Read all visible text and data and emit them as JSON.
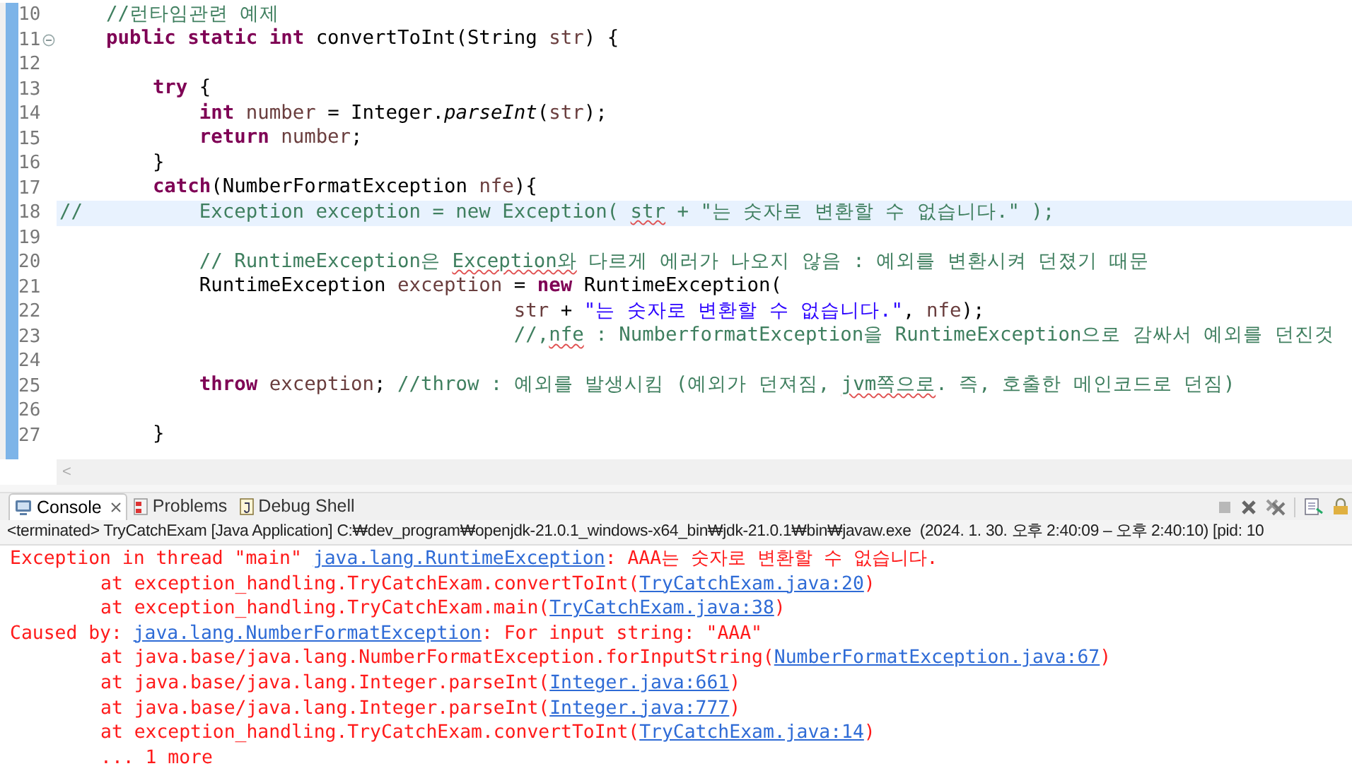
{
  "editor": {
    "lines": [
      {
        "number": "10",
        "current": false,
        "fold": false,
        "tokens": [
          {
            "kind": "comment",
            "text": "    //런타임관련 예제"
          }
        ]
      },
      {
        "number": "11",
        "current": false,
        "fold": true,
        "tokens": [
          {
            "kind": "keyword",
            "text": "    public static int"
          },
          {
            "kind": "plain",
            "text": " convertToInt(String "
          },
          {
            "kind": "variable",
            "text": "str"
          },
          {
            "kind": "plain",
            "text": ") {"
          }
        ]
      },
      {
        "number": "12",
        "current": false,
        "fold": false
      },
      {
        "number": "13",
        "current": false,
        "fold": false,
        "tokens": [
          {
            "kind": "keyword",
            "text": "        try"
          },
          {
            "kind": "plain",
            "text": " {"
          }
        ]
      },
      {
        "number": "14",
        "current": false,
        "fold": false,
        "tokens": [
          {
            "kind": "keyword",
            "text": "            int"
          },
          {
            "kind": "variable",
            "text": " number"
          },
          {
            "kind": "plain",
            "text": " = Integer."
          },
          {
            "kind": "method",
            "text": "parseInt"
          },
          {
            "kind": "plain",
            "text": "("
          },
          {
            "kind": "variable",
            "text": "str"
          },
          {
            "kind": "plain",
            "text": ");"
          }
        ]
      },
      {
        "number": "15",
        "current": false,
        "fold": false,
        "tokens": [
          {
            "kind": "keyword",
            "text": "            return"
          },
          {
            "kind": "variable",
            "text": " number"
          },
          {
            "kind": "plain",
            "text": ";"
          }
        ]
      },
      {
        "number": "16",
        "current": false,
        "fold": false,
        "tokens": [
          {
            "kind": "plain",
            "text": "        }"
          }
        ]
      },
      {
        "number": "17",
        "current": false,
        "fold": false,
        "tokens": [
          {
            "kind": "keyword",
            "text": "        catch"
          },
          {
            "kind": "plain",
            "text": "(NumberFormatException "
          },
          {
            "kind": "variable",
            "text": "nfe"
          },
          {
            "kind": "plain",
            "text": "){"
          }
        ]
      },
      {
        "number": "18",
        "current": true,
        "fold": false,
        "tokens": [
          {
            "kind": "comment",
            "text": "//          Exception exception = new Exception( "
          },
          {
            "kind": "typo",
            "text": "str"
          },
          {
            "kind": "comment",
            "text": " + \"는 숫자로 변환할 수 없습니다.\" );"
          }
        ]
      },
      {
        "number": "19",
        "current": false,
        "fold": false
      },
      {
        "number": "20",
        "current": false,
        "fold": false,
        "tokens": [
          {
            "kind": "comment",
            "text": "            // RuntimeException은 "
          },
          {
            "kind": "typo",
            "text": "Exception와"
          },
          {
            "kind": "comment",
            "text": " 다르게 에러가 나오지 않음 : 예외를 변환시켜 던졌기 때문"
          }
        ]
      },
      {
        "number": "21",
        "current": false,
        "fold": false,
        "tokens": [
          {
            "kind": "plain",
            "text": "            RuntimeException "
          },
          {
            "kind": "variable",
            "text": "exception"
          },
          {
            "kind": "plain",
            "text": " = "
          },
          {
            "kind": "keyword",
            "text": "new"
          },
          {
            "kind": "plain",
            "text": " RuntimeException("
          }
        ]
      },
      {
        "number": "22",
        "current": false,
        "fold": false,
        "tokens": [
          {
            "kind": "variable",
            "text": "                                       str"
          },
          {
            "kind": "plain",
            "text": " + "
          },
          {
            "kind": "string",
            "text": "\"는 숫자로 변환할 수 없습니다.\""
          },
          {
            "kind": "plain",
            "text": ", "
          },
          {
            "kind": "variable",
            "text": "nfe"
          },
          {
            "kind": "plain",
            "text": ");"
          }
        ]
      },
      {
        "number": "23",
        "current": false,
        "fold": false,
        "tokens": [
          {
            "kind": "comment",
            "text": "                                       //,"
          },
          {
            "kind": "typo",
            "text": "nfe"
          },
          {
            "kind": "comment",
            "text": " : NumberformatException을 RuntimeException으로 감싸서 예외를 던진것"
          }
        ]
      },
      {
        "number": "24",
        "current": false,
        "fold": false
      },
      {
        "number": "25",
        "current": false,
        "fold": false,
        "tokens": [
          {
            "kind": "keyword",
            "text": "            throw"
          },
          {
            "kind": "variable",
            "text": " exception"
          },
          {
            "kind": "plain",
            "text": "; "
          },
          {
            "kind": "comment",
            "text": "//throw : 예외를 발생시킴 (예외가 던져짐, "
          },
          {
            "kind": "typo",
            "text": "jvm쪽으로"
          },
          {
            "kind": "comment",
            "text": ". 즉, 호출한 메인코드로 던짐)"
          }
        ]
      },
      {
        "number": "26",
        "current": false,
        "fold": false
      },
      {
        "number": "27",
        "current": false,
        "fold": false,
        "tokens": [
          {
            "kind": "plain",
            "text": "        }"
          }
        ]
      }
    ],
    "scroll_left": "<"
  },
  "tabs": [
    {
      "label": "Console",
      "selected": true,
      "closable": true
    },
    {
      "label": "Problems",
      "selected": false,
      "closable": false
    },
    {
      "label": "Debug Shell",
      "selected": false,
      "closable": false
    }
  ],
  "launch_info": "<terminated> TryCatchExam [Java Application] C:₩dev_program₩openjdk-21.0.1_windows-x64_bin₩jdk-21.0.1₩bin₩javaw.exe  (2024. 1. 30. 오후 2:40:09 – 오후 2:40:10) [pid: 10",
  "console": [
    [
      {
        "kind": "error",
        "text": "Exception in thread \"main\" "
      },
      {
        "kind": "link",
        "text": "java.lang.RuntimeException"
      },
      {
        "kind": "error",
        "text": ": AAA는 숫자로 변환할 수 없습니다."
      }
    ],
    [
      {
        "kind": "error",
        "text": "\tat exception_handling.TryCatchExam.convertToInt("
      },
      {
        "kind": "link",
        "text": "TryCatchExam.java:20"
      },
      {
        "kind": "error",
        "text": ")"
      }
    ],
    [
      {
        "kind": "error",
        "text": "\tat exception_handling.TryCatchExam.main("
      },
      {
        "kind": "link",
        "text": "TryCatchExam.java:38"
      },
      {
        "kind": "error",
        "text": ")"
      }
    ],
    [
      {
        "kind": "error",
        "text": "Caused by: "
      },
      {
        "kind": "link",
        "text": "java.lang.NumberFormatException"
      },
      {
        "kind": "error",
        "text": ": For input string: \"AAA\""
      }
    ],
    [
      {
        "kind": "error",
        "text": "\tat java.base/java.lang.NumberFormatException.forInputString("
      },
      {
        "kind": "link",
        "text": "NumberFormatException.java:67"
      },
      {
        "kind": "error",
        "text": ")"
      }
    ],
    [
      {
        "kind": "error",
        "text": "\tat java.base/java.lang.Integer.parseInt("
      },
      {
        "kind": "link",
        "text": "Integer.java:661"
      },
      {
        "kind": "error",
        "text": ")"
      }
    ],
    [
      {
        "kind": "error",
        "text": "\tat java.base/java.lang.Integer.parseInt("
      },
      {
        "kind": "link",
        "text": "Integer.java:777"
      },
      {
        "kind": "error",
        "text": ")"
      }
    ],
    [
      {
        "kind": "error",
        "text": "\tat exception_handling.TryCatchExam.convertToInt("
      },
      {
        "kind": "link",
        "text": "TryCatchExam.java:14"
      },
      {
        "kind": "error",
        "text": ")"
      }
    ],
    [
      {
        "kind": "error",
        "text": "\t... 1 more"
      }
    ]
  ]
}
